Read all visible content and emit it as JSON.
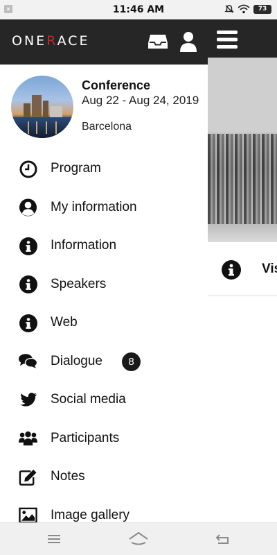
{
  "status_bar": {
    "time": "11:46 AM",
    "battery": "73"
  },
  "header": {
    "logo_left": "ONE",
    "logo_accent": "R",
    "logo_right": "ACE"
  },
  "conference": {
    "title": "Conference",
    "dates": "Aug 22 - Aug 24, 2019",
    "city": "Barcelona"
  },
  "menu": {
    "items": [
      {
        "label": "Program",
        "icon": "clock-icon"
      },
      {
        "label": "My information",
        "icon": "user-circle-icon"
      },
      {
        "label": "Information",
        "icon": "info-icon"
      },
      {
        "label": "Speakers",
        "icon": "info-icon"
      },
      {
        "label": "Web",
        "icon": "info-icon"
      },
      {
        "label": "Dialogue",
        "icon": "chat-bubbles-icon",
        "badge": "8"
      },
      {
        "label": "Social media",
        "icon": "twitter-icon"
      },
      {
        "label": "Participants",
        "icon": "users-icon"
      },
      {
        "label": "Notes",
        "icon": "edit-icon"
      },
      {
        "label": "Image gallery",
        "icon": "image-icon"
      }
    ]
  },
  "background_page": {
    "row_text": "Vis"
  },
  "colors": {
    "header_bg": "#262626",
    "logo_accent": "#c62828",
    "badge_bg": "#1a1a1a"
  }
}
